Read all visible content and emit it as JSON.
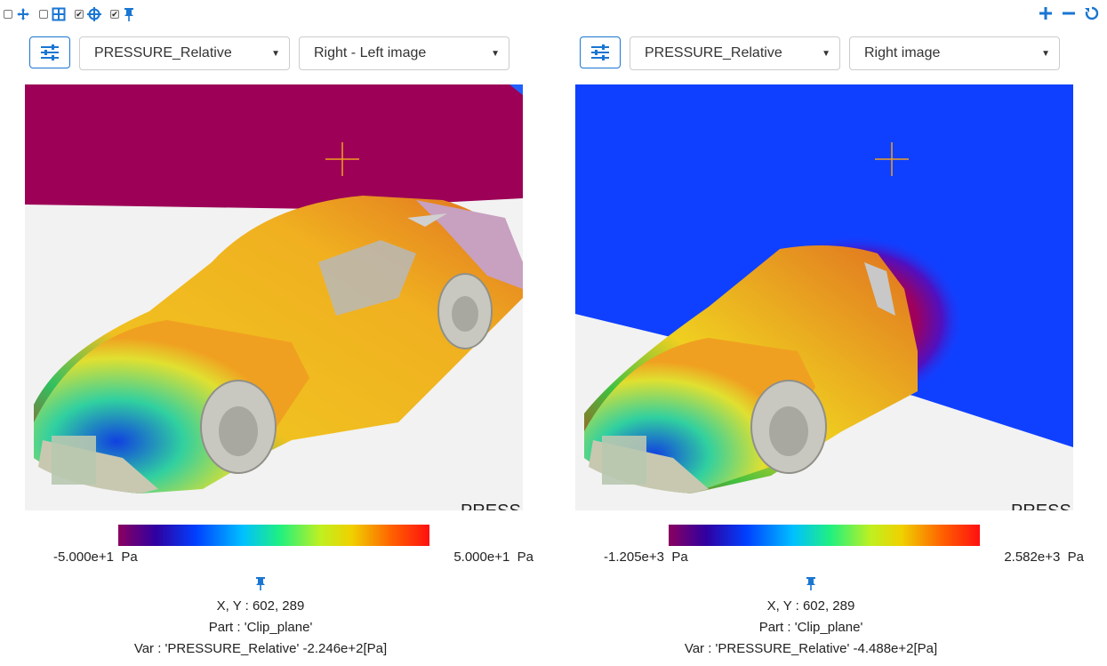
{
  "toolbar": {
    "checkboxes": [
      {
        "icon": "move-icon",
        "checked": false
      },
      {
        "icon": "grid-icon",
        "checked": false
      },
      {
        "icon": "crosshair-icon",
        "checked": true
      },
      {
        "icon": "pin-icon",
        "checked": true
      }
    ],
    "zoom": {
      "in_icon": "plus-icon",
      "out_icon": "minus-icon",
      "reset_icon": "reset-icon"
    }
  },
  "panels": [
    {
      "variable": "PRESSURE_Relative",
      "image_mode": "Right - Left image",
      "watermark": "PRESS",
      "legend": {
        "min_value": "-5.000e+1",
        "min_unit": "Pa",
        "max_value": "5.000e+1",
        "max_unit": "Pa"
      },
      "probe": {
        "xy": "X, Y : 602, 289",
        "part": "Part : 'Clip_plane'",
        "var": "Var : 'PRESSURE_Relative' -2.246e+2[Pa]"
      }
    },
    {
      "variable": "PRESSURE_Relative",
      "image_mode": "Right image",
      "watermark": "PRESS",
      "legend": {
        "min_value": "-1.205e+3",
        "min_unit": "Pa",
        "max_value": "2.582e+3",
        "max_unit": "Pa"
      },
      "probe": {
        "xy": "X, Y : 602, 289",
        "part": "Part : 'Clip_plane'",
        "var": "Var : 'PRESSURE_Relative' -4.488e+2[Pa]"
      }
    }
  ],
  "colors": {
    "accent": "#1976d2",
    "cursor": "#f0a020"
  }
}
